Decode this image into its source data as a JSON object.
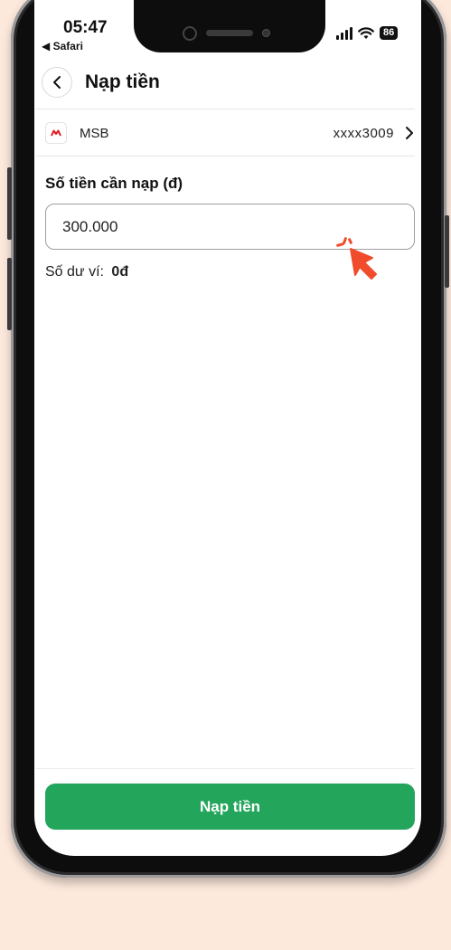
{
  "status_bar": {
    "time": "05:47",
    "back_app": "◀ Safari",
    "battery": "86"
  },
  "header": {
    "title": "Nạp tiền",
    "back_icon": "chevron-left-icon"
  },
  "bank": {
    "name": "MSB",
    "account": "xxxx3009",
    "logo_color": "#e21b23"
  },
  "amount": {
    "label": "Số tiền cần nạp (đ)",
    "value": "300.000"
  },
  "balance": {
    "label": "Số dư ví:",
    "value": "0đ"
  },
  "submit": {
    "label": "Nạp tiền",
    "color": "#24a55c"
  },
  "annotation": {
    "pointer_color": "#f04b2a",
    "icon": "click-pointer-icon"
  }
}
